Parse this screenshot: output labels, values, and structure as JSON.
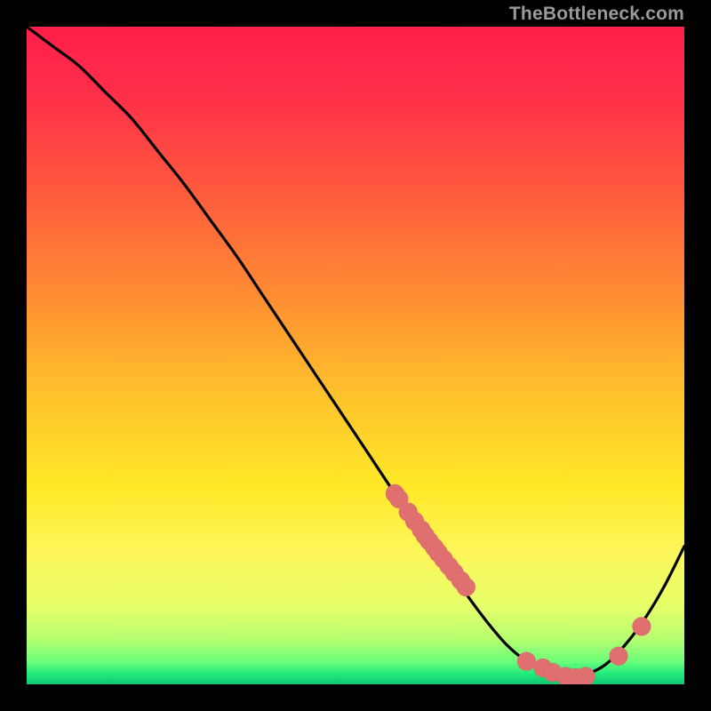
{
  "watermark": "TheBottleneck.com",
  "colors": {
    "bg": "#000000",
    "curve": "#000000",
    "marker_fill": "#e07070",
    "marker_stroke": "#d86666",
    "gradient_stops": [
      {
        "offset": 0.0,
        "color": "#ff1f4a"
      },
      {
        "offset": 0.1,
        "color": "#ff2e49"
      },
      {
        "offset": 0.25,
        "color": "#ff5a3e"
      },
      {
        "offset": 0.4,
        "color": "#ff8a33"
      },
      {
        "offset": 0.55,
        "color": "#ffbf2c"
      },
      {
        "offset": 0.7,
        "color": "#ffe928"
      },
      {
        "offset": 0.8,
        "color": "#fdf65a"
      },
      {
        "offset": 0.88,
        "color": "#e7ff6a"
      },
      {
        "offset": 0.93,
        "color": "#b8ff70"
      },
      {
        "offset": 0.965,
        "color": "#6cff7a"
      },
      {
        "offset": 0.985,
        "color": "#20e87a"
      },
      {
        "offset": 1.0,
        "color": "#0fc574"
      }
    ]
  },
  "chart_data": {
    "type": "line",
    "title": "",
    "xlabel": "",
    "ylabel": "",
    "xlim": [
      0,
      100
    ],
    "ylim": [
      0,
      100
    ],
    "series": [
      {
        "name": "bottleneck-curve",
        "x": [
          0,
          4,
          8,
          12,
          16,
          20,
          24,
          28,
          32,
          36,
          40,
          44,
          48,
          52,
          56,
          60,
          64,
          67,
          70,
          73,
          76,
          79,
          82,
          85,
          88,
          91,
          94,
          97,
          100
        ],
        "y": [
          100,
          97,
          94,
          90,
          86,
          81,
          76,
          70.5,
          65,
          59,
          53,
          47,
          41,
          35,
          29,
          23.5,
          18,
          13.5,
          9.5,
          6,
          3.5,
          1.8,
          1,
          1.5,
          3,
          6,
          10,
          15,
          21
        ]
      }
    ],
    "markers": {
      "name": "highlight-points",
      "x": [
        56,
        56.6,
        58,
        59,
        60,
        60.6,
        61.2,
        62,
        62.6,
        63.4,
        64.2,
        65,
        66,
        66.8,
        76,
        78.5,
        80,
        82,
        83.5,
        85,
        90,
        93.5
      ],
      "y": [
        29,
        28.2,
        26.2,
        24.8,
        23.5,
        22.6,
        21.8,
        20.8,
        20,
        19,
        18,
        17,
        15.8,
        14.8,
        3.5,
        2.5,
        1.8,
        1.2,
        1.0,
        1.2,
        4.3,
        8.8
      ],
      "r": 1.4
    }
  }
}
